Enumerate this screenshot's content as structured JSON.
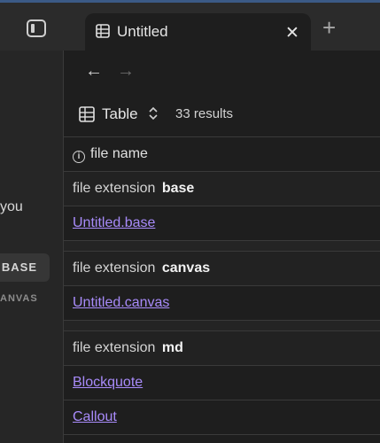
{
  "tab": {
    "title": "Untitled",
    "close": "✕",
    "new_tab": "+"
  },
  "nav": {
    "back": "←",
    "forward": "→"
  },
  "sidebar": {
    "fragment": "you",
    "chip_base": "BASE",
    "canvas_label": "ANVAS"
  },
  "view": {
    "label": "Table",
    "switch_icon": "⌃⌄",
    "results": "33 results"
  },
  "table": {
    "column_header": "file name",
    "group_prefix": "file extension",
    "groups": [
      {
        "extension": "base",
        "items": [
          "Untitled.base"
        ]
      },
      {
        "extension": "canvas",
        "items": [
          "Untitled.canvas"
        ]
      },
      {
        "extension": "md",
        "items": [
          "Blockquote",
          "Callout"
        ]
      }
    ]
  },
  "colors": {
    "accent_link": "#a88bfa",
    "background": "#1e1e1e",
    "sidebar": "#262626"
  }
}
